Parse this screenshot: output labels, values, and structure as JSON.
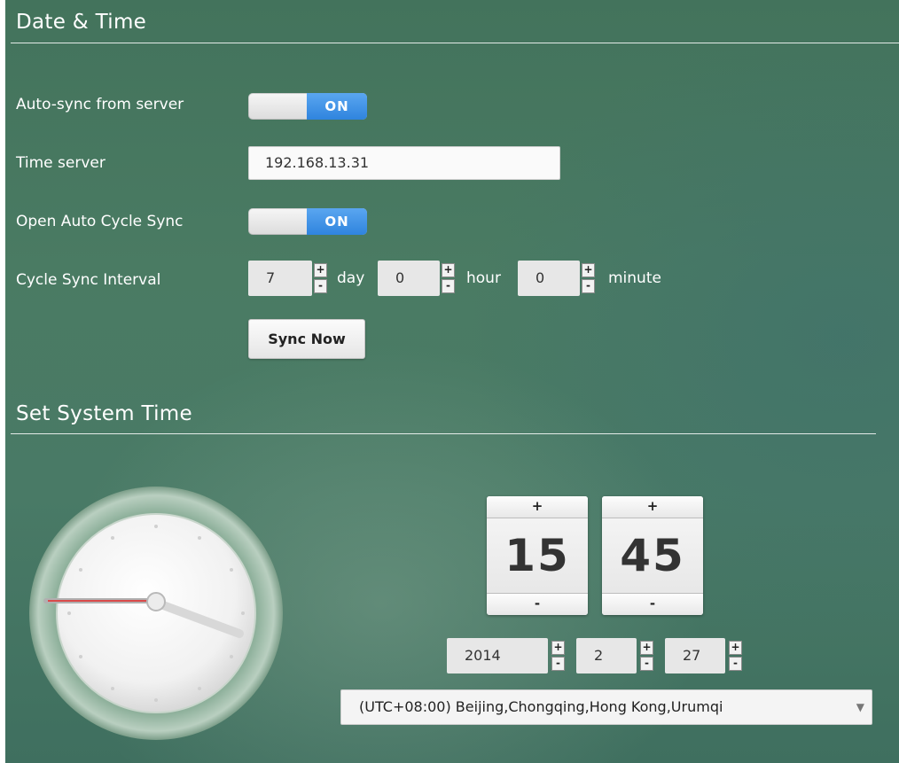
{
  "date_time_section": {
    "title": "Date & Time",
    "auto_sync": {
      "label": "Auto-sync from server",
      "state": "ON"
    },
    "time_server": {
      "label": "Time server",
      "value": "192.168.13.31"
    },
    "auto_cycle_sync": {
      "label": "Open Auto Cycle Sync",
      "state": "ON"
    },
    "cycle_interval": {
      "label": "Cycle Sync Interval",
      "day": {
        "value": "7",
        "unit": "day"
      },
      "hour": {
        "value": "0",
        "unit": "hour"
      },
      "minute": {
        "value": "0",
        "unit": "minute"
      }
    },
    "sync_now_label": "Sync Now"
  },
  "system_time_section": {
    "title": "Set System Time",
    "hour": "15",
    "minute": "45",
    "year": "2014",
    "month": "2",
    "day": "27",
    "timezone": "(UTC+08:00) Beijing,Chongqing,Hong Kong,Urumqi"
  },
  "controls": {
    "plus": "+",
    "minus": "-",
    "dropdown_arrow": "▼"
  },
  "colors": {
    "toggle_on": "#3b8ee6",
    "background": "#4a7b63"
  }
}
